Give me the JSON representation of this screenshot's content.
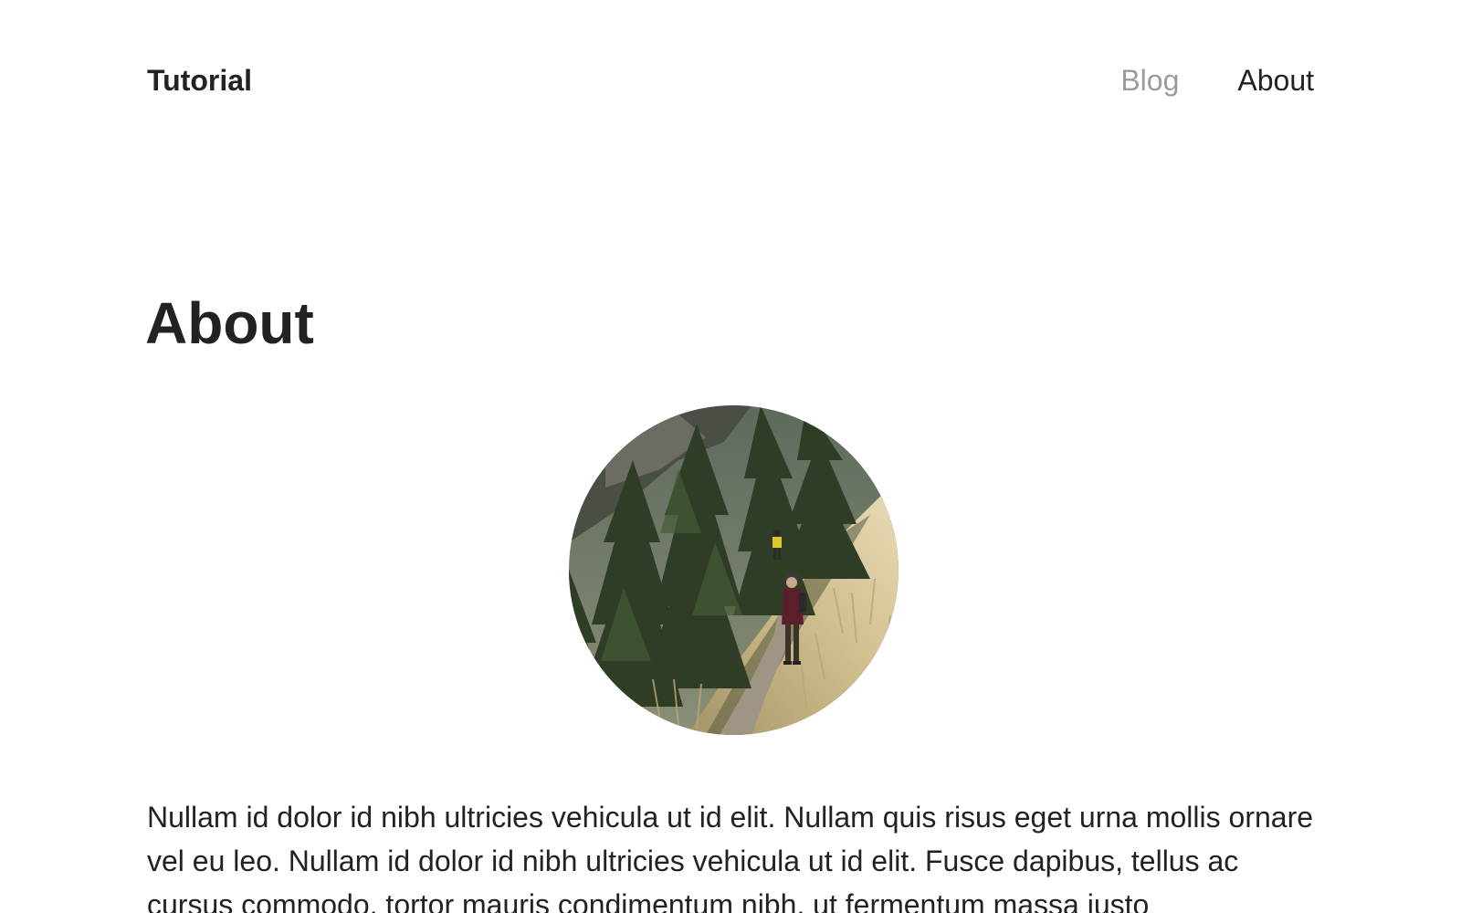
{
  "site": {
    "title": "Tutorial"
  },
  "nav": {
    "items": [
      {
        "label": "Blog",
        "active": false
      },
      {
        "label": "About",
        "active": true
      }
    ]
  },
  "page": {
    "title": "About",
    "image_alt": "Hikers on a grassy hillside trail among pine trees",
    "body": "Nullam id dolor id nibh ultricies vehicula ut id elit. Nullam quis risus eget urna mollis ornare vel eu leo. Nullam id dolor id nibh ultricies vehicula ut id elit. Fusce dapibus, tellus ac cursus commodo, tortor mauris condimentum nibh, ut fermentum massa justo"
  },
  "colors": {
    "text": "#222222",
    "nav_inactive": "#9b9b9b",
    "background": "#ffffff"
  }
}
